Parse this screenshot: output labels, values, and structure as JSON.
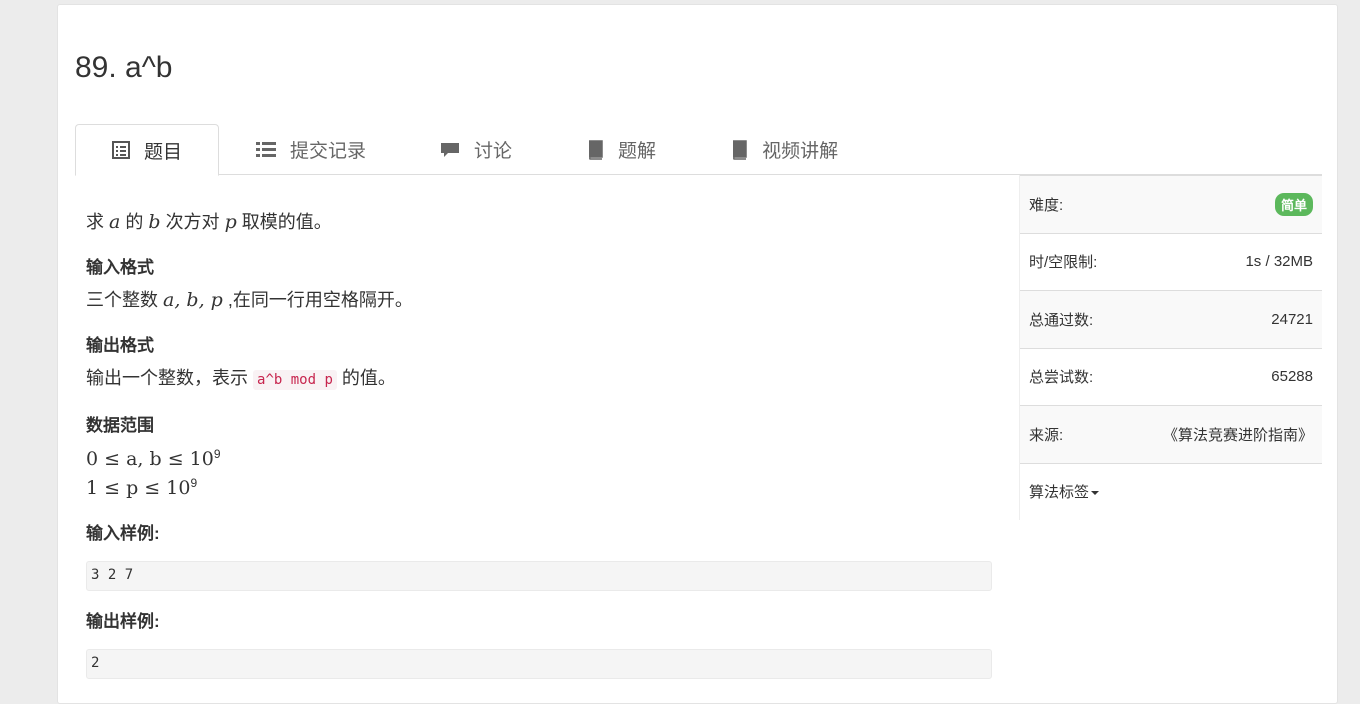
{
  "problem": {
    "title": "89. a^b"
  },
  "tabs": [
    {
      "label": "题目",
      "icon": "list-alt-icon",
      "active": true
    },
    {
      "label": "提交记录",
      "icon": "list-icon",
      "active": false
    },
    {
      "label": "讨论",
      "icon": "comment-icon",
      "active": false
    },
    {
      "label": "题解",
      "icon": "book-icon",
      "active": false
    },
    {
      "label": "视频讲解",
      "icon": "book-icon",
      "active": false
    }
  ],
  "statement": {
    "p1_a": "求",
    "var_a": "a",
    "p1_b": "的",
    "var_b": "b",
    "p1_c": "次方对",
    "var_p": "p",
    "p1_d": "取模的值。",
    "input_heading": "输入格式",
    "input_a": "三个整数",
    "input_vars": "a, b, p",
    "input_b": ",在同一行用空格隔开。",
    "output_heading": "输出格式",
    "output_a": "输出一个整数，表示",
    "output_code": "a^b mod p",
    "output_b": "的值。",
    "range_heading": "数据范围",
    "range1": "0 ≤ a, b ≤ 10",
    "range1_sup": "9",
    "range2": "1 ≤ p ≤ 10",
    "range2_sup": "9",
    "sample_in_heading": "输入样例:",
    "sample_in": "3 2 7",
    "sample_out_heading": "输出样例:",
    "sample_out": "2"
  },
  "sidebar": {
    "difficulty_label": "难度:",
    "difficulty_value": "简单",
    "limit_label": "时/空限制:",
    "limit_value": "1s / 32MB",
    "passed_label": "总通过数:",
    "passed_value": "24721",
    "tried_label": "总尝试数:",
    "tried_value": "65288",
    "source_label": "来源:",
    "source_value": "《算法竞赛进阶指南》",
    "tags_label": "算法标签"
  },
  "colors": {
    "badge_green": "#5cb85c",
    "code_red": "#c7254e"
  }
}
